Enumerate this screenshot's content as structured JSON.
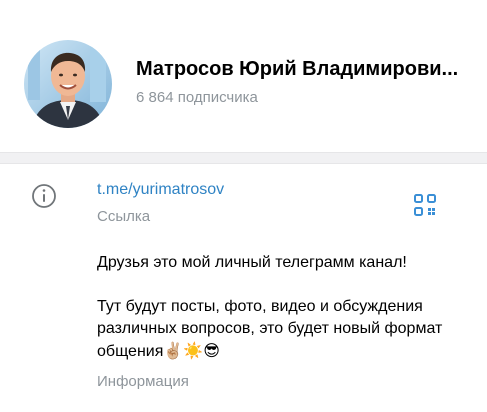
{
  "channel": {
    "name": "Матросов Юрий Владимирови...",
    "subscribers": "6 864 подписчика"
  },
  "info": {
    "link_text": "t.me/yurimatrosov",
    "link_caption": "Ссылка",
    "description_line1": "Друзья это мой личный телеграмм канал!",
    "description_line2": "Тут будут посты, фото, видео и обсуждения различных вопросов, это будет новый формат общения",
    "description_emoji": "✌🏼☀️😎",
    "description_caption": "Информация"
  },
  "icons": {
    "info": "info-icon",
    "qr": "qr-code-icon"
  },
  "colors": {
    "link": "#2f83c4",
    "secondary_text": "#8e959b",
    "qr_accent": "#3a8fd6"
  }
}
